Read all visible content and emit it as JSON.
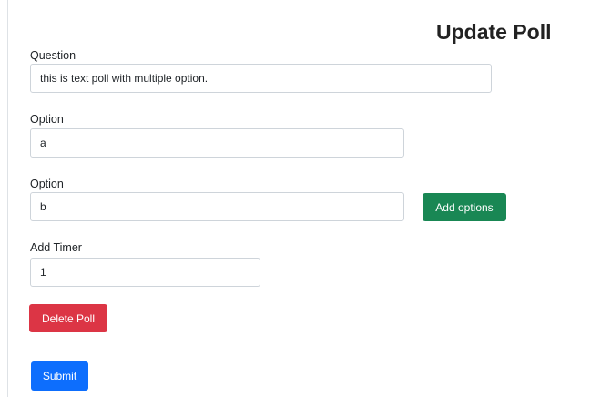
{
  "page": {
    "title": "Update Poll"
  },
  "question": {
    "label": "Question",
    "value": "this is text poll with multiple option."
  },
  "options": [
    {
      "label": "Option",
      "value": "a"
    },
    {
      "label": "Option",
      "value": "b"
    }
  ],
  "add_options_label": "Add options",
  "timer": {
    "label": "Add Timer",
    "value": "1"
  },
  "delete_label": "Delete Poll",
  "submit_label": "Submit",
  "colors": {
    "success": "#198754",
    "danger": "#dc3545",
    "primary": "#0d6efd",
    "input_border": "#ced4da"
  }
}
